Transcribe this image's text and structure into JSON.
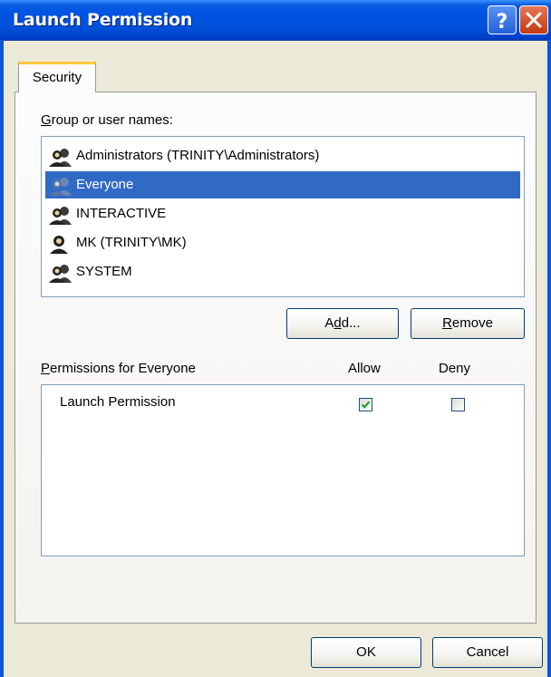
{
  "window": {
    "title": "Launch Permission"
  },
  "tabs": [
    {
      "label": "Security",
      "active": true
    }
  ],
  "group_section": {
    "label_underline": "G",
    "label_rest": "roup or user names:",
    "users": [
      {
        "name": "Administrators (TRINITY\\Administrators)",
        "icon": "group-icon",
        "selected": false
      },
      {
        "name": "Everyone",
        "icon": "group-icon",
        "selected": true
      },
      {
        "name": "INTERACTIVE",
        "icon": "group-icon",
        "selected": false
      },
      {
        "name": "MK (TRINITY\\MK)",
        "icon": "user-icon",
        "selected": false
      },
      {
        "name": "SYSTEM",
        "icon": "group-icon",
        "selected": false
      }
    ]
  },
  "buttons": {
    "add_pre": "A",
    "add_u": "d",
    "add_post": "d...",
    "remove_u": "R",
    "remove_rest": "emove",
    "ok": "OK",
    "cancel": "Cancel"
  },
  "permissions_section": {
    "label_underline": "P",
    "label_rest": "ermissions for Everyone",
    "allow_header": "Allow",
    "deny_header": "Deny",
    "rows": [
      {
        "name": "Launch Permission",
        "allow": true,
        "deny": false
      }
    ]
  },
  "colors": {
    "titlebar": "#0054E3",
    "selection": "#316AC5",
    "dialog_bg": "#ECE9D8",
    "checkmark": "#21A121"
  }
}
